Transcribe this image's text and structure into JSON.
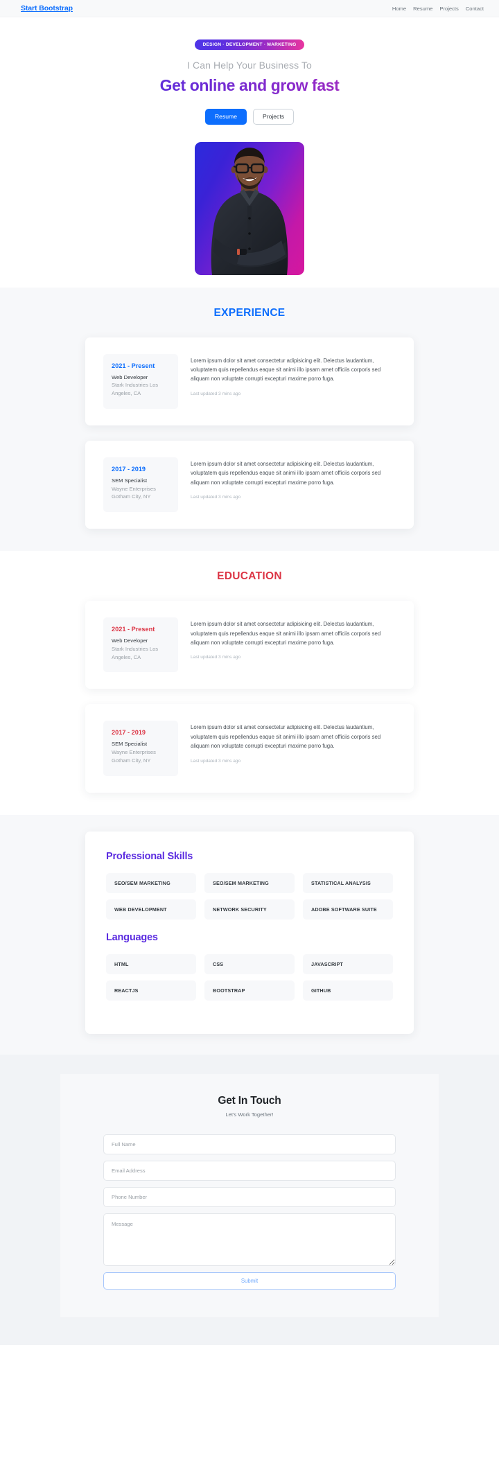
{
  "navbar": {
    "brand": "Start Bootstrap",
    "links": [
      {
        "label": "Home"
      },
      {
        "label": "Resume"
      },
      {
        "label": "Projects"
      },
      {
        "label": "Contact"
      }
    ]
  },
  "hero": {
    "badge": "DESIGN · DEVELOPMENT · MARKETING",
    "subtitle": "I Can Help Your Business To",
    "title": "Get online and grow fast",
    "primary_button": "Resume",
    "secondary_button": "Projects",
    "portrait_alt": "smiling-man-in-dark-shirt-with-glasses-arms-crossed",
    "gradient_start": "#2b2bdd",
    "gradient_end": "#d6179e"
  },
  "experience": {
    "title": "EXPERIENCE",
    "accent": "#0d6efd",
    "items": [
      {
        "date": "2021 - Present",
        "role": "Web Developer",
        "org": "Stark Industries Los Angeles, CA",
        "text": "Lorem ipsum dolor sit amet consectetur adipisicing elit. Delectus laudantium, voluptatem quis repellendus eaque sit animi illo ipsam amet officiis corporis sed aliquam non voluptate corrupti excepturi maxime porro fuga.",
        "meta": "Last updated 3 mins ago"
      },
      {
        "date": "2017 - 2019",
        "role": "SEM Specialist",
        "org": "Wayne Enterprises Gotham City, NY",
        "text": "Lorem ipsum dolor sit amet consectetur adipisicing elit. Delectus laudantium, voluptatem quis repellendus eaque sit animi illo ipsam amet officiis corporis sed aliquam non voluptate corrupti excepturi maxime porro fuga.",
        "meta": "Last updated 3 mins ago"
      }
    ]
  },
  "education": {
    "title": "EDUCATION",
    "accent": "#dc3545",
    "items": [
      {
        "date": "2021 - Present",
        "role": "Web Developer",
        "org": "Stark Industries Los Angeles, CA",
        "text": "Lorem ipsum dolor sit amet consectetur adipisicing elit. Delectus laudantium, voluptatem quis repellendus eaque sit animi illo ipsam amet officiis corporis sed aliquam non voluptate corrupti excepturi maxime porro fuga.",
        "meta": "Last updated 3 mins ago"
      },
      {
        "date": "2017 - 2019",
        "role": "SEM Specialist",
        "org": "Wayne Enterprises Gotham City, NY",
        "text": "Lorem ipsum dolor sit amet consectetur adipisicing elit. Delectus laudantium, voluptatem quis repellendus eaque sit animi illo ipsam amet officiis corporis sed aliquam non voluptate corrupti excepturi maxime porro fuga.",
        "meta": "Last updated 3 mins ago"
      }
    ]
  },
  "skills": {
    "accent": "#5b2ce0",
    "professional_heading": "Professional Skills",
    "professional_items": [
      "SEO/SEM MARKETING",
      "SEO/SEM MARKETING",
      "STATISTICAL ANALYSIS",
      "WEB DEVELOPMENT",
      "NETWORK SECURITY",
      "ADOBE SOFTWARE SUITE"
    ],
    "languages_heading": "Languages",
    "language_items": [
      "HTML",
      "CSS",
      "JAVASCRIPT",
      "REACTJS",
      "BOOTSTRAP",
      "GITHUB"
    ]
  },
  "contact": {
    "title": "Get In Touch",
    "subtitle": "Let's Work Together!",
    "fields": {
      "name_placeholder": "Full Name",
      "email_placeholder": "Email Address",
      "phone_placeholder": "Phone Number",
      "message_placeholder": "Message"
    },
    "submit_label": "Submit"
  }
}
